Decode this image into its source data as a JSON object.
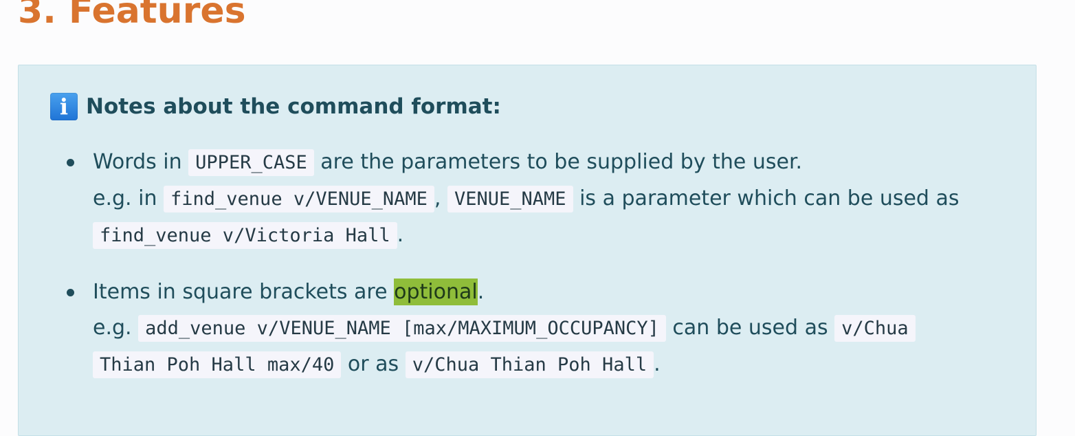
{
  "heading": "3. Features",
  "callout": {
    "title": "Notes about the command format:",
    "icon": "info-icon",
    "items": [
      {
        "l1_before": "Words in",
        "l1_code": "UPPER_CASE",
        "l1_after": "are the parameters to be supplied by the user.",
        "l2_eg": "e.g. in",
        "l2_code1": "find_venue v/VENUE_NAME",
        "l2_comma": ",",
        "l2_code2": "VENUE_NAME",
        "l2_after": "is a parameter which can be used as",
        "l3_code": "find_venue v/Victoria Hall",
        "l3_period": "."
      },
      {
        "l1_before": "Items in square brackets are",
        "l1_highlight": "optional",
        "l1_period": ".",
        "l2_eg": "e.g.",
        "l2_code1": "add_venue v/VENUE_NAME [max/MAXIMUM_OCCUPANCY]",
        "l2_mid": "can be used as",
        "l2_code2_part1": "v/Chua",
        "l3_code2_part2": "Thian Poh Hall max/40",
        "l3_or": "or as",
        "l3_code3": "v/Chua Thian Poh Hall",
        "l3_period": "."
      }
    ]
  },
  "colors": {
    "heading": "#d9742f",
    "callout_bg": "#dcedf2",
    "text": "#1f4d5b",
    "highlight": "#8fbd3a"
  }
}
